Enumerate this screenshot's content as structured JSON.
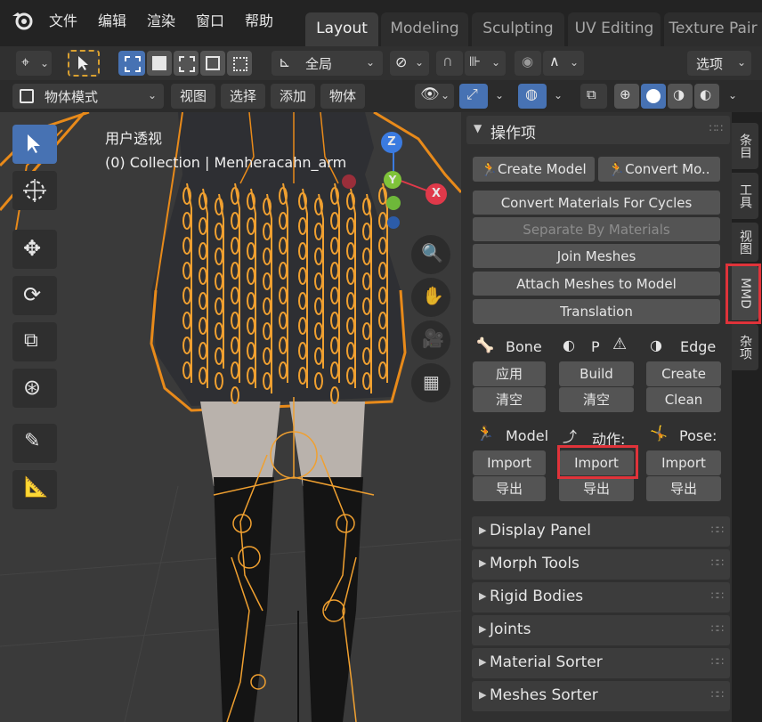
{
  "menu": {
    "items": [
      "文件",
      "编辑",
      "渲染",
      "窗口",
      "帮助"
    ]
  },
  "workspaces": {
    "tabs": [
      "Layout",
      "Modeling",
      "Sculpting",
      "UV Editing",
      "Texture Pair"
    ],
    "active": "Layout"
  },
  "toolbar": {
    "transform_orientation": "全局",
    "options_label": "选项"
  },
  "header": {
    "mode": "物体模式",
    "menus": [
      "视图",
      "选择",
      "添加",
      "物体"
    ]
  },
  "viewport": {
    "view_name": "用户透视",
    "collection_info": "(0) Collection | Menheracahn_arm",
    "gizmo_axes": {
      "z": "Z",
      "y": "Y",
      "x": "X"
    }
  },
  "panel": {
    "title": "操作项",
    "create_model": "Create Model",
    "convert_model": "Convert Mo..",
    "convert_materials": "Convert Materials For Cycles",
    "separate_by_materials": "Separate By Materials",
    "join_meshes": "Join Meshes",
    "attach_meshes": "Attach Meshes to Model",
    "translation": "Translation",
    "bone_label": "Bone",
    "p_label": "P",
    "edge_label": "Edge",
    "bone_apply": "应用",
    "bone_clear": "清空",
    "p_build": "Build",
    "p_clear": "清空",
    "edge_create": "Create",
    "edge_clean": "Clean",
    "model_label": "Model",
    "motion_label": "动作:",
    "pose_label": "Pose:",
    "model_import": "Import",
    "model_export": "导出",
    "motion_import": "Import",
    "motion_export": "导出",
    "pose_import": "Import",
    "pose_export": "导出",
    "sections": [
      "Display Panel",
      "Morph Tools",
      "Rigid Bodies",
      "Joints",
      "Material Sorter",
      "Meshes Sorter"
    ]
  },
  "side_tabs": [
    "条目",
    "工具",
    "视图",
    "MMD",
    "杂项"
  ],
  "highlight_color": "#e0333a",
  "accent_color": "#4772b3",
  "armature_color": "#f0a030"
}
